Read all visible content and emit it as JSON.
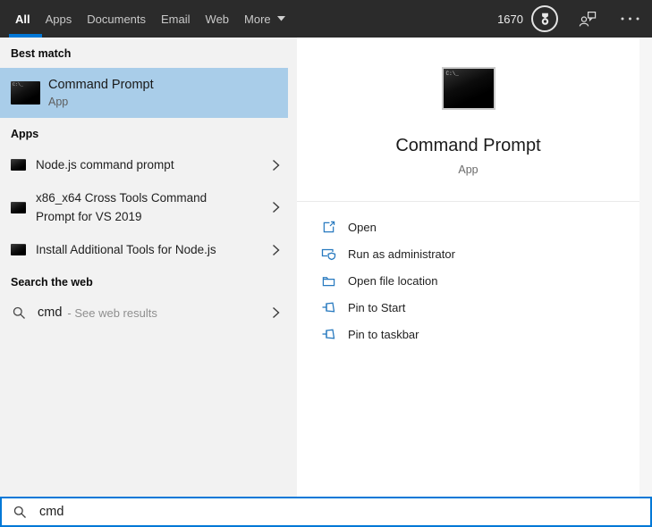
{
  "topbar": {
    "tabs": [
      {
        "label": "All",
        "active": true
      },
      {
        "label": "Apps"
      },
      {
        "label": "Documents"
      },
      {
        "label": "Email"
      },
      {
        "label": "Web"
      },
      {
        "label": "More",
        "has_dropdown": true
      }
    ],
    "rewards_points": "1670"
  },
  "left": {
    "best_match_header": "Best match",
    "best_match": {
      "title": "Command Prompt",
      "subtitle": "App"
    },
    "apps_header": "Apps",
    "apps": [
      {
        "label": "Node.js command prompt"
      },
      {
        "label": "x86_x64 Cross Tools Command Prompt for VS 2019"
      },
      {
        "label": "Install Additional Tools for Node.js"
      }
    ],
    "search_web_header": "Search the web",
    "web_item": {
      "query": "cmd",
      "suffix": "- See web results"
    }
  },
  "right": {
    "title": "Command Prompt",
    "subtitle": "App",
    "actions": [
      {
        "label": "Open"
      },
      {
        "label": "Run as administrator"
      },
      {
        "label": "Open file location"
      },
      {
        "label": "Pin to Start"
      },
      {
        "label": "Pin to taskbar"
      }
    ]
  },
  "icons": {
    "prompt_screen_text": "C:\\_"
  },
  "search_bar": {
    "value": "cmd"
  },
  "colors": {
    "accent": "#0078d7",
    "highlight": "#a9cde9",
    "topbar_bg": "#2b2b2b",
    "action_icon": "#2779bf"
  }
}
